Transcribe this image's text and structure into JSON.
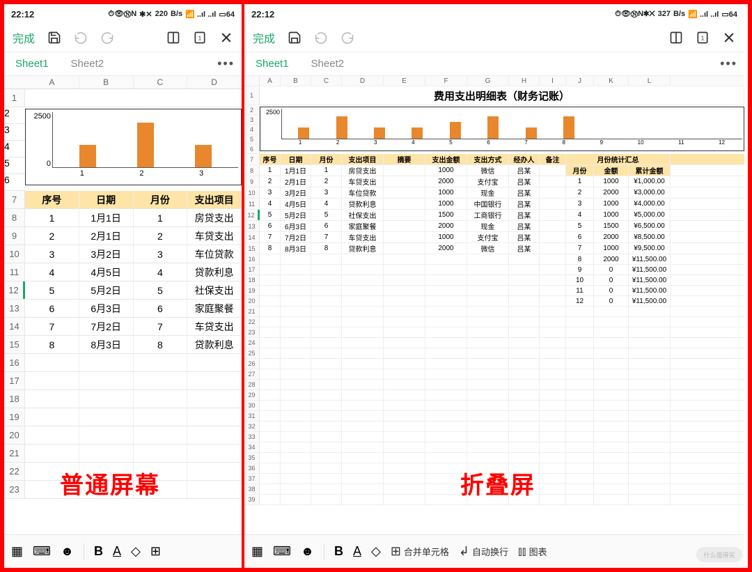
{
  "status": {
    "time": "22:12",
    "battery": "64",
    "net_left": "220",
    "net_right": "327",
    "unit": "B/s"
  },
  "toolbar": {
    "done": "完成"
  },
  "tabs": [
    "Sheet1",
    "Sheet2"
  ],
  "left": {
    "cols": [
      "A",
      "B",
      "C",
      "D"
    ],
    "header_row": 7,
    "selected_row": 12,
    "headers": [
      "序号",
      "日期",
      "月份",
      "支出项目"
    ],
    "rows": [
      {
        "n": 8,
        "a": "1",
        "b": "1月1日",
        "c": "1",
        "d": "房贷支出"
      },
      {
        "n": 9,
        "a": "2",
        "b": "2月1日",
        "c": "2",
        "d": "车贷支出"
      },
      {
        "n": 10,
        "a": "3",
        "b": "3月2日",
        "c": "3",
        "d": "车位贷款"
      },
      {
        "n": 11,
        "a": "4",
        "b": "4月5日",
        "c": "4",
        "d": "贷款利息"
      },
      {
        "n": 12,
        "a": "5",
        "b": "5月2日",
        "c": "5",
        "d": "社保支出"
      },
      {
        "n": 13,
        "a": "6",
        "b": "6月3日",
        "c": "6",
        "d": "家庭聚餐"
      },
      {
        "n": 14,
        "a": "7",
        "b": "7月2日",
        "c": "7",
        "d": "车贷支出"
      },
      {
        "n": 15,
        "a": "8",
        "b": "8月3日",
        "c": "8",
        "d": "贷款利息"
      }
    ],
    "empty_rows": [
      16,
      17,
      18,
      19,
      20,
      21,
      22,
      23
    ],
    "overlay": "普通屏幕",
    "chart_prerows": [
      1,
      2,
      3,
      4,
      5
    ],
    "chart": {
      "y_max_label": "2500",
      "y_min_label": "0",
      "x": [
        "1",
        "2",
        "3"
      ]
    }
  },
  "right": {
    "title": "费用支出明细表（财务记账）",
    "cols": [
      "A",
      "B",
      "C",
      "D",
      "E",
      "F",
      "G",
      "H",
      "I",
      "J",
      "K",
      "L"
    ],
    "header_row": 7,
    "selected_row": 12,
    "headers_main": [
      "序号",
      "日期",
      "月份",
      "支出项目",
      "摘要",
      "支出金额",
      "支出方式",
      "经办人",
      "备注"
    ],
    "headers_sum_top": "月份统计汇总",
    "headers_sum": [
      "月份",
      "金额",
      "累计金额"
    ],
    "rows": [
      {
        "n": 8,
        "a": "1",
        "b": "1月1日",
        "c": "1",
        "d": "房贷支出",
        "e": "",
        "f": "1000",
        "g": "微信",
        "h": "吕某"
      },
      {
        "n": 9,
        "a": "2",
        "b": "2月1日",
        "c": "2",
        "d": "车贷支出",
        "e": "",
        "f": "2000",
        "g": "支付宝",
        "h": "吕某"
      },
      {
        "n": 10,
        "a": "3",
        "b": "3月2日",
        "c": "3",
        "d": "车位贷款",
        "e": "",
        "f": "1000",
        "g": "现金",
        "h": "吕某"
      },
      {
        "n": 11,
        "a": "4",
        "b": "4月5日",
        "c": "4",
        "d": "贷款利息",
        "e": "",
        "f": "1000",
        "g": "中国银行",
        "h": "吕某"
      },
      {
        "n": 12,
        "a": "5",
        "b": "5月2日",
        "c": "5",
        "d": "社保支出",
        "e": "",
        "f": "1500",
        "g": "工商银行",
        "h": "吕某"
      },
      {
        "n": 13,
        "a": "6",
        "b": "6月3日",
        "c": "6",
        "d": "家庭聚餐",
        "e": "",
        "f": "2000",
        "g": "现金",
        "h": "吕某"
      },
      {
        "n": 14,
        "a": "7",
        "b": "7月2日",
        "c": "7",
        "d": "车贷支出",
        "e": "",
        "f": "1000",
        "g": "支付宝",
        "h": "吕某"
      },
      {
        "n": 15,
        "a": "8",
        "b": "8月3日",
        "c": "8",
        "d": "贷款利息",
        "e": "",
        "f": "2000",
        "g": "微信",
        "h": "吕某"
      }
    ],
    "summary": [
      {
        "n": 8,
        "j": "1",
        "k": "1000",
        "l": "¥1,000.00"
      },
      {
        "n": 9,
        "j": "2",
        "k": "2000",
        "l": "¥3,000.00"
      },
      {
        "n": 10,
        "j": "3",
        "k": "1000",
        "l": "¥4,000.00"
      },
      {
        "n": 11,
        "j": "4",
        "k": "1000",
        "l": "¥5,000.00"
      },
      {
        "n": 12,
        "j": "5",
        "k": "1500",
        "l": "¥6,500.00"
      },
      {
        "n": 13,
        "j": "6",
        "k": "2000",
        "l": "¥8,500.00"
      },
      {
        "n": 14,
        "j": "7",
        "k": "1000",
        "l": "¥9,500.00"
      },
      {
        "n": 15,
        "j": "8",
        "k": "2000",
        "l": "¥11,500.00"
      },
      {
        "n": 16,
        "j": "9",
        "k": "0",
        "l": "¥11,500.00"
      },
      {
        "n": 17,
        "j": "10",
        "k": "0",
        "l": "¥11,500.00"
      },
      {
        "n": 18,
        "j": "11",
        "k": "0",
        "l": "¥11,500.00"
      },
      {
        "n": 19,
        "j": "12",
        "k": "0",
        "l": "¥11,500.00"
      }
    ],
    "empty_rows": [
      20,
      21,
      22,
      23,
      24,
      25,
      26,
      27,
      28,
      29,
      30,
      31,
      32,
      33,
      34,
      35,
      36,
      37,
      38,
      39
    ],
    "overlay": "折叠屏",
    "chart": {
      "y_max_label": "2500",
      "x": [
        "1",
        "2",
        "3",
        "4",
        "5",
        "6",
        "7",
        "8",
        "9",
        "10",
        "11",
        "12"
      ]
    }
  },
  "chart_data": [
    {
      "panel": "left-phone",
      "type": "bar",
      "title": "",
      "xlabel": "",
      "ylabel": "",
      "ylim": [
        0,
        2500
      ],
      "categories": [
        "1",
        "2",
        "3"
      ],
      "values": [
        1000,
        2000,
        1000
      ]
    },
    {
      "panel": "right-phone",
      "type": "bar",
      "title": "费用支出明细表（财务记账）",
      "xlabel": "",
      "ylabel": "",
      "ylim": [
        0,
        2500
      ],
      "categories": [
        "1",
        "2",
        "3",
        "4",
        "5",
        "6",
        "7",
        "8",
        "9",
        "10",
        "11",
        "12"
      ],
      "values": [
        1000,
        2000,
        1000,
        1000,
        1500,
        2000,
        1000,
        2000,
        0,
        0,
        0,
        0
      ]
    }
  ],
  "bottombar": {
    "merge": "合并单元格",
    "wrap": "自动换行",
    "chart": "图表"
  },
  "watermark": "什么值得买"
}
